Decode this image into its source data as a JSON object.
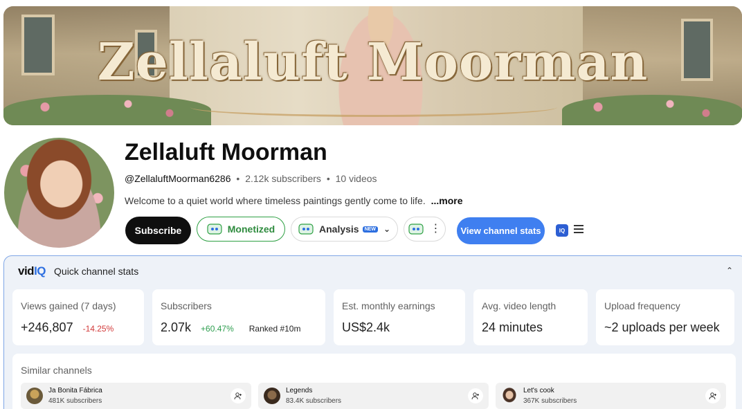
{
  "banner": {
    "title": "Zellaluft Moorman"
  },
  "channel": {
    "name": "Zellaluft Moorman",
    "handle": "@ZellaluftMoorman6286",
    "subscribers": "2.12k subscribers",
    "videos": "10 videos",
    "separator": "•",
    "description": "Welcome to a quiet world where timeless paintings gently come to life.",
    "more_label": "...more"
  },
  "actions": {
    "subscribe_label": "Subscribe",
    "monetized_label": "Monetized",
    "analysis_label": "Analysis",
    "new_badge": "NEW",
    "view_stats_label": "View channel stats",
    "iq_badge": "IQ"
  },
  "panel": {
    "logo_prefix": "vid",
    "logo_suffix": "IQ",
    "title": "Quick channel stats",
    "stats": [
      {
        "label": "Views gained (7 days)",
        "value": "+246,807",
        "delta": "-14.25%"
      },
      {
        "label": "Subscribers",
        "value": "2.07k",
        "delta": "+60.47%",
        "rank": "Ranked #10m"
      },
      {
        "label": "Est. monthly earnings",
        "value": "US$2.4k"
      },
      {
        "label": "Avg. video length",
        "value": "24 minutes"
      },
      {
        "label": "Upload frequency",
        "value": "~2 uploads per week"
      }
    ],
    "similar": {
      "title": "Similar channels",
      "items": [
        {
          "name": "Ja Bonita Fábrica",
          "subs": "481K subscribers"
        },
        {
          "name": "Legends",
          "subs": "83.4K subscribers"
        },
        {
          "name": "Let's cook",
          "subs": "367K subscribers"
        }
      ]
    }
  },
  "colors": {
    "accent_blue": "#3f7ff0",
    "monetized_green": "#2ea043",
    "negative": "#d23a3a",
    "positive": "#2e9e4f"
  },
  "icons": {
    "vidiq": "vidiq-mascot-icon",
    "chevron": "chevron-down-icon",
    "more": "more-vertical-icon",
    "menu": "menu-icon",
    "collapse": "chevron-up-icon",
    "add_channel": "add-user-icon"
  }
}
